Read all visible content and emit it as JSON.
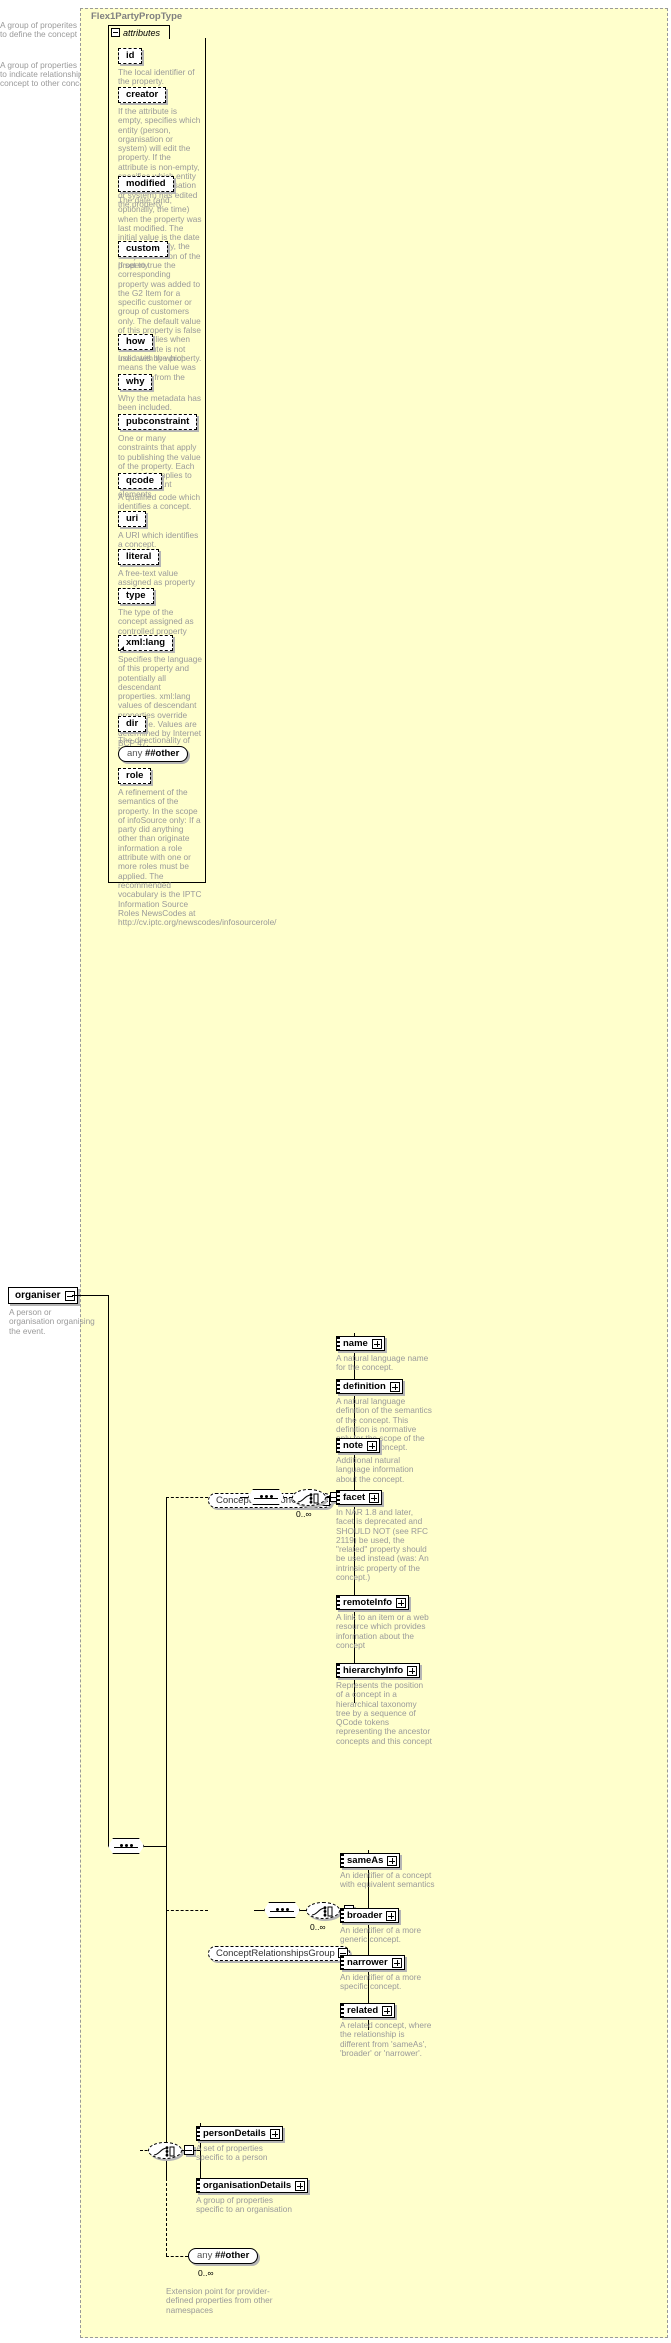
{
  "type_frame": {
    "title": "Flex1PartyPropType"
  },
  "attributes_section": {
    "tab_label": "attributes"
  },
  "root_element": {
    "name": "organiser",
    "doc": "A person or organisation organising the event."
  },
  "attributes": [
    {
      "name": "id",
      "doc": "The local identifier of the property."
    },
    {
      "name": "creator",
      "doc": "If the attribute is empty, specifies which entity (person, organisation or system) will edit the property. If the attribute is non-empty, specifies which entity (person, organisation or system) has edited the property."
    },
    {
      "name": "modified",
      "doc": "The date (and, optionally, the time) when the property was last modified. The initial value is the date (and, optionally, the time) of creation of the property."
    },
    {
      "name": "custom",
      "doc": "If set to true the corresponding property was added to the G2 Item for a specific customer or group of customers only. The default value of this property is false which applies when this attribute is not used with the property."
    },
    {
      "name": "how",
      "doc": "Indicates by which means the value was extracted from the content."
    },
    {
      "name": "why",
      "doc": "Why the metadata has been included."
    },
    {
      "name": "pubconstraint",
      "doc": "One or many constraints that apply to publishing the value of the property. Each constraint applies to all descendant elements."
    },
    {
      "name": "qcode",
      "doc": "A qualified code which identifies a concept."
    },
    {
      "name": "uri",
      "doc": "A URI which identifies a concept."
    },
    {
      "name": "literal",
      "doc": "A free-text value assigned as property value."
    },
    {
      "name": "type",
      "doc": "The type of the concept assigned as controlled property value."
    },
    {
      "name": "xml:lang",
      "doc": "Specifies the language of this property and potentially all descendant properties. xml:lang values of descendant properties override this value. Values are determined by Internet BCP 47."
    },
    {
      "name": "dir",
      "doc": "The directionality of textual content."
    },
    {
      "name": "any ##other",
      "doc": "",
      "kind": "any",
      "any_word": "any",
      "any_ns": "##other"
    },
    {
      "name": "role",
      "doc": "A refinement of the semantics of the property. In the scope of infoSource only: If a party did anything other than originate information a role attribute with one or more roles must be applied. The recommended vocabulary is the IPTC Information Source Roles NewsCodes at http://cv.iptc.org/newscodes/infosourcerole/"
    }
  ],
  "groups": [
    {
      "name": "ConceptDefinitionGroup",
      "doc": "A group of properites required to define the concept",
      "occurs": "0..∞",
      "elements": [
        {
          "name": "name",
          "doc": "A natural language name for the concept."
        },
        {
          "name": "definition",
          "doc": "A natural language definition of the semantics of the concept. This definition is normative only for the scope of the use of this concept."
        },
        {
          "name": "note",
          "doc": "Additional natural language information about the concept."
        },
        {
          "name": "facet",
          "doc": "In NAR 1.8 and later, facet is deprecated and SHOULD NOT (see RFC 2119) be used, the \"related\" property should be used instead (was: An intrinsic property of the concept.)"
        },
        {
          "name": "remoteInfo",
          "doc": "A link to an item or a web resource which provides information about the concept"
        },
        {
          "name": "hierarchyInfo",
          "doc": "Represents the position of a concept in a hierarchical taxonomy tree by a sequence of QCode tokens representing the ancestor concepts and this concept"
        }
      ]
    },
    {
      "name": "ConceptRelationshipsGroup",
      "doc": "A group of properties required to indicate relationships of the concept to other concepts",
      "occurs": "0..∞",
      "elements": [
        {
          "name": "sameAs",
          "doc": "An identifier of a concept with equivalent semantics"
        },
        {
          "name": "broader",
          "doc": "An identifier of a more generic concept."
        },
        {
          "name": "narrower",
          "doc": "An identifier of a more specific concept."
        },
        {
          "name": "related",
          "doc": "A related concept, where the relationship is different from 'sameAs', 'broader' or 'narrower'."
        }
      ]
    }
  ],
  "detail_choice": {
    "elements": [
      {
        "name": "personDetails",
        "doc": "A set of properties specific to a person"
      },
      {
        "name": "organisationDetails",
        "doc": "A group of properties specific to an organisation"
      }
    ]
  },
  "any_element": {
    "any_word": "any",
    "any_ns": "##other",
    "occurs": "0..∞",
    "doc": "Extension point for provider-defined properties from other namespaces"
  },
  "colors": {
    "frame_bg": "#ffffcc",
    "doc_text": "#9a9a9a",
    "frame_title": "#808080",
    "line": "#000000"
  }
}
